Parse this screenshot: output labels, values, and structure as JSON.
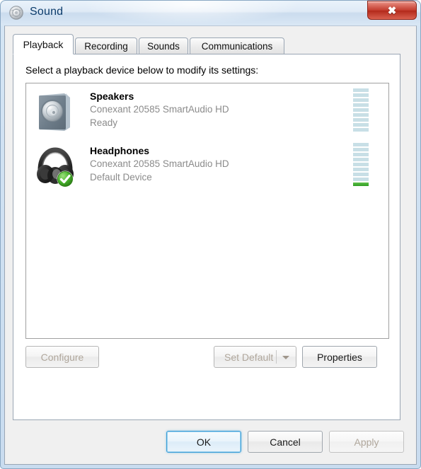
{
  "window": {
    "title": "Sound",
    "icon": "sound-speaker-icon",
    "close_label": "✕"
  },
  "tabs": [
    {
      "label": "Playback",
      "active": true
    },
    {
      "label": "Recording",
      "active": false
    },
    {
      "label": "Sounds",
      "active": false
    },
    {
      "label": "Communications",
      "active": false
    }
  ],
  "playback": {
    "instruction": "Select a playback device below to modify its settings:",
    "devices": [
      {
        "name": "Speakers",
        "driver": "Conexant 20585 SmartAudio HD",
        "state": "Ready",
        "icon": "speaker-icon",
        "is_default": false,
        "meter_segments": 9,
        "meter_active": 0
      },
      {
        "name": "Headphones",
        "driver": "Conexant 20585 SmartAudio HD",
        "state": "Default Device",
        "icon": "headphones-icon",
        "is_default": true,
        "meter_segments": 9,
        "meter_active": 1
      }
    ],
    "actions": {
      "configure": "Configure",
      "set_default": "Set Default",
      "properties": "Properties"
    }
  },
  "footer": {
    "ok": "OK",
    "cancel": "Cancel",
    "apply": "Apply"
  },
  "colors": {
    "accent": "#3c9fd8",
    "meter_idle": "#c8dfe6",
    "meter_active": "#2f9c22",
    "close_button": "#c1392b",
    "title_text": "#0c3c6b",
    "muted_text": "#8b8b8b"
  }
}
